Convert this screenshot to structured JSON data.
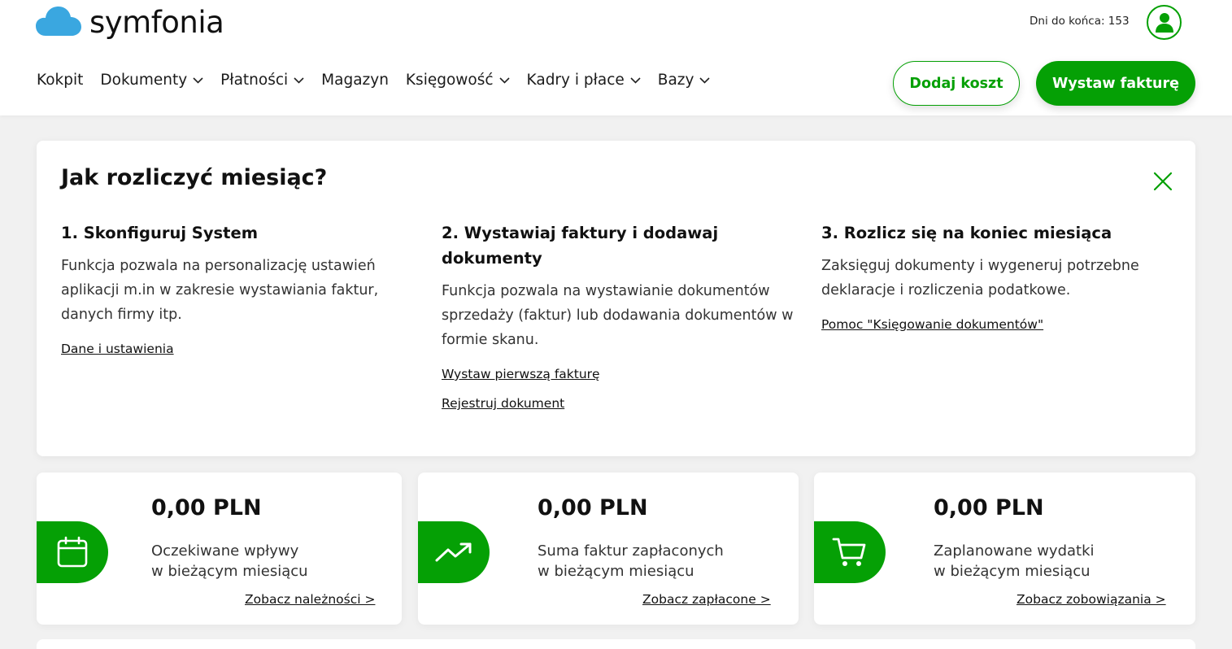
{
  "brand": {
    "name": "symfonia",
    "accent_color": "#05a005",
    "logo_cloud_color": "#3aa7e0"
  },
  "header": {
    "days_left": "Dni do końca: 153",
    "user_icon": "user-avatar-icon",
    "nav": [
      {
        "label": "Kokpit",
        "has_dropdown": false
      },
      {
        "label": "Dokumenty",
        "has_dropdown": true
      },
      {
        "label": "Płatności",
        "has_dropdown": true
      },
      {
        "label": "Magazyn",
        "has_dropdown": false
      },
      {
        "label": "Księgowość",
        "has_dropdown": true
      },
      {
        "label": "Kadry i płace",
        "has_dropdown": true
      },
      {
        "label": "Bazy",
        "has_dropdown": true
      }
    ],
    "add_cost_label": "Dodaj koszt",
    "issue_invoice_label": "Wystaw fakturę"
  },
  "guide": {
    "title": "Jak rozliczyć miesiąc?",
    "close_icon": "close-icon",
    "steps": [
      {
        "title": "1. Skonfiguruj System",
        "description": "Funkcja pozwala na personalizację ustawień aplikacji m.in w zakresie wystawiania faktur, danych firmy itp.",
        "links": [
          "Dane i ustawienia"
        ]
      },
      {
        "title": "2. Wystawiaj faktury i dodawaj dokumenty",
        "description": "Funkcja pozwala na wystawianie dokumentów sprzedaży (faktur) lub dodawania dokumentów w formie skanu.",
        "links": [
          "Wystaw pierwszą fakturę",
          "Rejestruj dokument"
        ]
      },
      {
        "title": "3. Rozlicz się na koniec miesiąca",
        "description": "Zaksięguj dokumenty i wygeneruj potrzebne deklaracje i rozliczenia podatkowe.",
        "links": [
          "Pomoc \"Księgowanie dokumentów\""
        ]
      }
    ]
  },
  "stats": [
    {
      "icon": "calendar-icon",
      "amount": "0,00 PLN",
      "label_line1": "Oczekiwane wpływy",
      "label_line2": "w bieżącym miesiącu",
      "link": "Zobacz należności >"
    },
    {
      "icon": "trending-up-icon",
      "amount": "0,00 PLN",
      "label_line1": "Suma faktur zapłaconych",
      "label_line2": "w bieżącym miesiącu",
      "link": "Zobacz zapłacone >"
    },
    {
      "icon": "shopping-cart-icon",
      "amount": "0,00 PLN",
      "label_line1": "Zaplanowane wydatki",
      "label_line2": "w bieżącym miesiącu",
      "link": "Zobacz zobowiązania >"
    }
  ]
}
